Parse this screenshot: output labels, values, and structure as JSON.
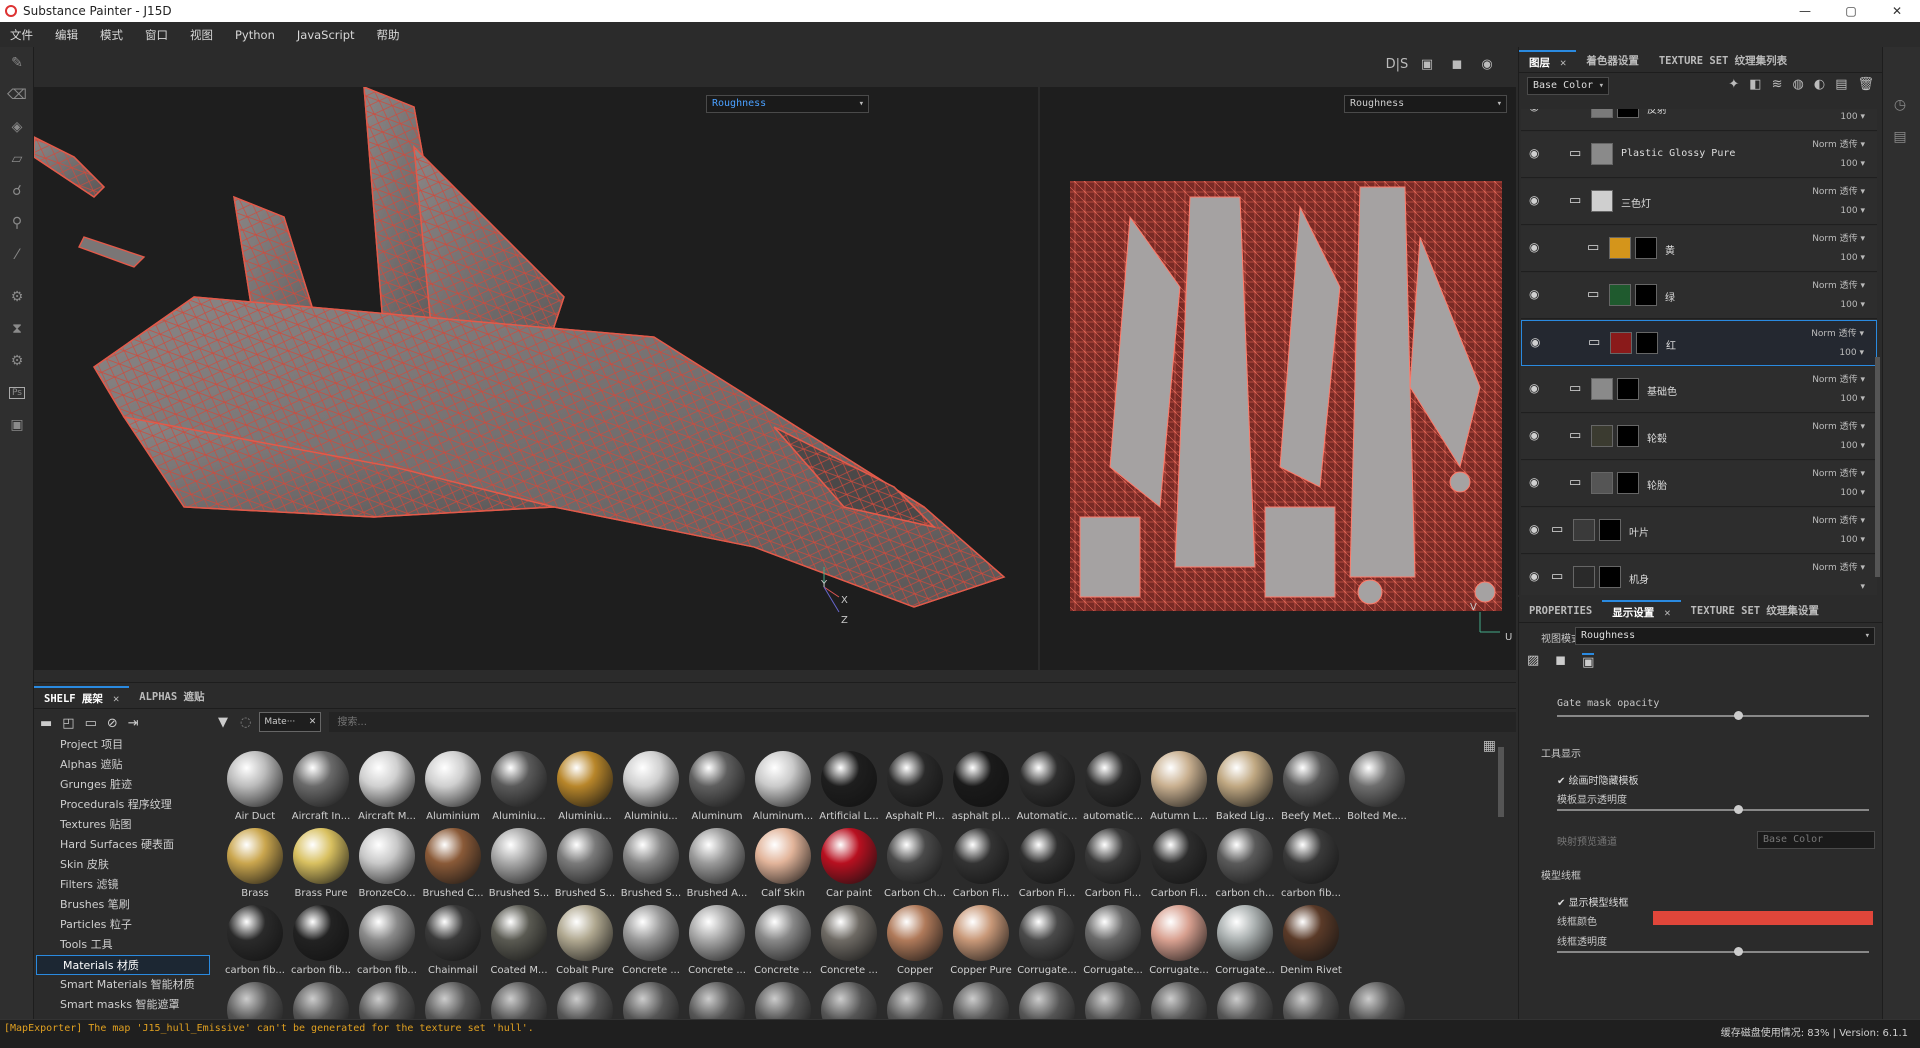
{
  "window": {
    "title": "Substance Painter - J15D",
    "controls": [
      "—",
      "▢",
      "✕"
    ]
  },
  "menu": [
    "文件",
    "编辑",
    "模式",
    "窗口",
    "视图",
    "Python",
    "JavaScript",
    "帮助"
  ],
  "left_tools": [
    "brush-icon",
    "eraser-icon",
    "projection-icon",
    "geometry-mask-icon",
    "smudge-icon",
    "clone-icon",
    "color-picker-icon",
    "settings-icon",
    "bake-icon",
    "export-icon",
    "photoshop-icon",
    "save-icon"
  ],
  "viewport": {
    "tools": [
      "D|S",
      "▣",
      "◼",
      "◉"
    ],
    "channel_3d": "Roughness",
    "channel_2d": "Roughness",
    "axes_3d": [
      "Y",
      "X",
      "Z"
    ],
    "axes_2d": [
      "V",
      "U"
    ]
  },
  "layers_panel": {
    "tabs": [
      "图层",
      "着色器设置",
      "TEXTURE SET 纹理集列表"
    ],
    "channel_select": "Base Color",
    "toolbar_icons": [
      "effect-icon",
      "mask-icon",
      "stack-icon",
      "fill-icon",
      "smart-icon",
      "folder-add-icon",
      "delete-icon"
    ],
    "rows": [
      {
        "name": "反射",
        "blend": "Norm",
        "opacity": "100",
        "thumb": "#7a7a7a",
        "mask": "#000",
        "indent": 1
      },
      {
        "name": "Plastic Glossy Pure",
        "blend": "Norm 透传",
        "opacity": "100",
        "thumb": "#8a8a8a",
        "mask": "",
        "indent": 1
      },
      {
        "name": "三色灯",
        "blend": "Norm 透传",
        "opacity": "100",
        "thumb": "#cfcfcf",
        "mask": "",
        "indent": 1
      },
      {
        "name": "黄",
        "blend": "Norm 透传",
        "opacity": "100",
        "thumb": "#d4951b",
        "mask": "#000",
        "indent": 2
      },
      {
        "name": "绿",
        "blend": "Norm 透传",
        "opacity": "100",
        "thumb": "#1f5a2e",
        "mask": "#000",
        "indent": 2
      },
      {
        "name": "红",
        "blend": "Norm 透传",
        "opacity": "100",
        "thumb": "#8a1a1a",
        "mask": "#000",
        "indent": 2
      },
      {
        "name": "基础色",
        "blend": "Norm 透传",
        "opacity": "100",
        "thumb": "#8a8a8a",
        "mask": "#000",
        "indent": 1
      },
      {
        "name": "轮毂",
        "blend": "Norm 透传",
        "opacity": "100",
        "thumb": "#3b3b30",
        "mask": "#000",
        "indent": 1
      },
      {
        "name": "轮胎",
        "blend": "Norm 透传",
        "opacity": "100",
        "thumb": "#555",
        "mask": "#000",
        "indent": 1
      },
      {
        "name": "叶片",
        "blend": "Norm 透传",
        "opacity": "100",
        "thumb": "#3a3a3a",
        "mask": "#000",
        "indent": 0
      },
      {
        "name": "机身",
        "blend": "Norm 透传",
        "opacity": "",
        "thumb": "#2a2a2a",
        "mask": "#000",
        "indent": 0
      }
    ]
  },
  "props_panel": {
    "tabs": [
      "PROPERTIES",
      "显示设置",
      "TEXTURE SET 纹理集设置"
    ],
    "view_mode_label": "视图模式",
    "view_mode_value": "Roughness",
    "gate_label": "Gate mask opacity",
    "gate_value": 0.58,
    "tool_section": "工具显示",
    "hide_cb": "绘画时隐藏模板",
    "template_opacity": "模板显示透明度",
    "template_value": 0.58,
    "map_label": "映射预览通道",
    "map_value": "Base Color",
    "wire_section": "模型线框",
    "wire_cb": "显示模型线框",
    "wire_color_label": "线框颜色",
    "wire_color": "#e0463a",
    "wire_opacity": "线框透明度",
    "wire_value": 0.58
  },
  "shelf": {
    "tabs": [
      "SHELF 展架",
      "ALPHAS 遮贴"
    ],
    "categories": [
      "Project 项目",
      "Alphas 遮贴",
      "Grunges 脏迹",
      "Procedurals 程序纹理",
      "Textures 贴图",
      "Hard Surfaces 硬表面",
      "Skin 皮肤",
      "Filters 滤镜",
      "Brushes 笔刷",
      "Particles 粒子",
      "Tools 工具",
      "Materials 材质",
      "Smart Materials 智能材质",
      "Smart masks 智能遮罩"
    ],
    "selected_category": "Materials 材质",
    "filter_chip": "Mate···",
    "search_placeholder": "搜索...",
    "materials": [
      [
        "Air Duct",
        "Aircraft In...",
        "Aircraft M...",
        "Aluminium",
        "Aluminiu...",
        "Aluminiu...",
        "Aluminiu...",
        "Aluminum",
        "Aluminum...",
        "Artificial L...",
        "Asphalt Pl...",
        "asphalt pl...",
        "Automatic...",
        "automatic...",
        "Autumn L...",
        "Baked Lig...",
        "Beefy Met...",
        "Bolted Me..."
      ],
      [
        "Brass",
        "Brass Pure",
        "BronzeCo...",
        "Brushed C...",
        "Brushed S...",
        "Brushed S...",
        "Brushed S...",
        "Brushed A...",
        "Calf Skin",
        "Car paint",
        "Carbon Ch...",
        "Carbon Fi...",
        "Carbon Fi...",
        "Carbon Fi...",
        "Carbon Fi...",
        "carbon ch...",
        "carbon fib..."
      ],
      [
        "carbon fib...",
        "carbon fib...",
        "carbon fib...",
        "Chainmail",
        "Coated M...",
        "Cobalt Pure",
        "Concrete ...",
        "Concrete ...",
        "Concrete ...",
        "Concrete ...",
        "Copper",
        "Copper Pure",
        "Corrugate...",
        "Corrugate...",
        "Corrugate...",
        "Corrugate...",
        "Denim Rivet"
      ]
    ],
    "row4_count": 18
  },
  "status": {
    "message": "[MapExporter] The map 'J15_hull_Emissive' can't be generated for the texture set 'hull'.",
    "right": "缓存磁盘使用情况:  83% | Version: 6.1.1"
  }
}
